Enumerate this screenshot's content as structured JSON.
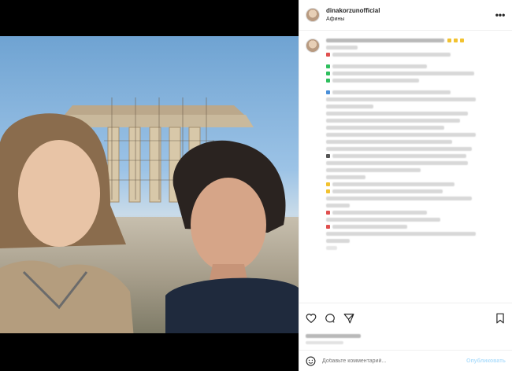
{
  "header": {
    "username": "dinakorzunofficial",
    "location": "Афины"
  },
  "comment": {
    "placeholder": "Добавьте комментарий...",
    "publish_label": "Опубликовать"
  },
  "icons": {
    "more": "more-horizontal-icon",
    "like": "heart-icon",
    "comment": "comment-icon",
    "share": "share-icon",
    "save": "bookmark-icon",
    "emoji": "smile-icon"
  },
  "colors": {
    "link_disabled": "#b2dffc",
    "marker_green": "#2fbf5e",
    "marker_red": "#e0504f",
    "marker_yellow": "#f2c230",
    "marker_blue": "#4a8fd9"
  }
}
